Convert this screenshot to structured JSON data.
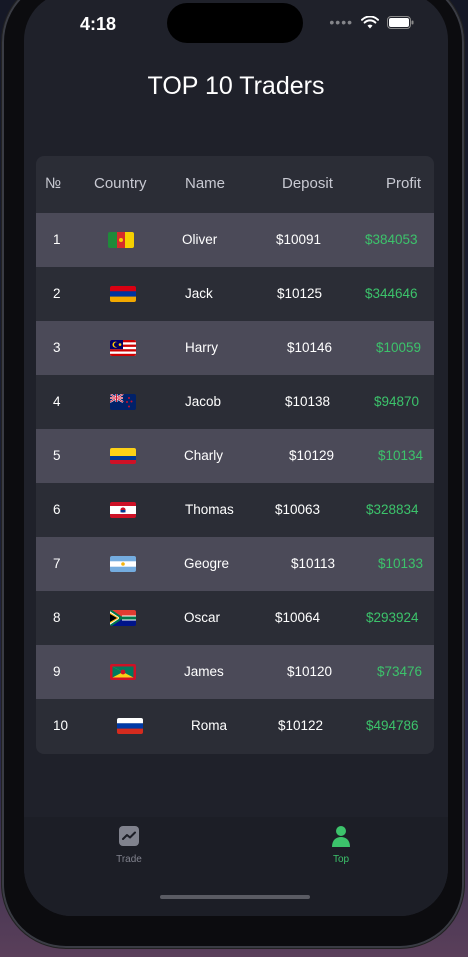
{
  "status_bar": {
    "time": "4:18"
  },
  "page": {
    "title": "TOP 10 Traders"
  },
  "table": {
    "headers": {
      "num": "№",
      "country": "Country",
      "name": "Name",
      "deposit": "Deposit",
      "profit": "Profit"
    },
    "rows": [
      {
        "num": "1",
        "flag": "cameroon-flag-icon",
        "name": "Oliver",
        "deposit": "$10091",
        "profit": "$384053"
      },
      {
        "num": "2",
        "flag": "armenia-flag-icon",
        "name": "Jack",
        "deposit": "$10125",
        "profit": "$344646"
      },
      {
        "num": "3",
        "flag": "malaysia-flag-icon",
        "name": "Harry",
        "deposit": "$10146",
        "profit": "$10059"
      },
      {
        "num": "4",
        "flag": "new-zealand-flag-icon",
        "name": "Jacob",
        "deposit": "$10138",
        "profit": "$94870"
      },
      {
        "num": "5",
        "flag": "colombia-flag-icon",
        "name": "Charly",
        "deposit": "$10129",
        "profit": "$10134"
      },
      {
        "num": "6",
        "flag": "french-polynesia-flag-icon",
        "name": "Thomas",
        "deposit": "$10063",
        "profit": "$328834"
      },
      {
        "num": "7",
        "flag": "argentina-flag-icon",
        "name": "Geogre",
        "deposit": "$10113",
        "profit": "$10133"
      },
      {
        "num": "8",
        "flag": "south-africa-flag-icon",
        "name": "Oscar",
        "deposit": "$10064",
        "profit": "$293924"
      },
      {
        "num": "9",
        "flag": "grenada-flag-icon",
        "name": "James",
        "deposit": "$10120",
        "profit": "$73476"
      },
      {
        "num": "10",
        "flag": "russia-flag-icon",
        "name": "Roma",
        "deposit": "$10122",
        "profit": "$494786"
      }
    ]
  },
  "tabbar": {
    "trade": {
      "label": "Trade",
      "icon": "chart-icon"
    },
    "top": {
      "label": "Top",
      "icon": "user-icon",
      "active": true
    }
  },
  "colors": {
    "background": "#1f212a",
    "accent": "#3cc36b",
    "alt_row": "#4b4a58",
    "panel": "#2b2d36"
  }
}
